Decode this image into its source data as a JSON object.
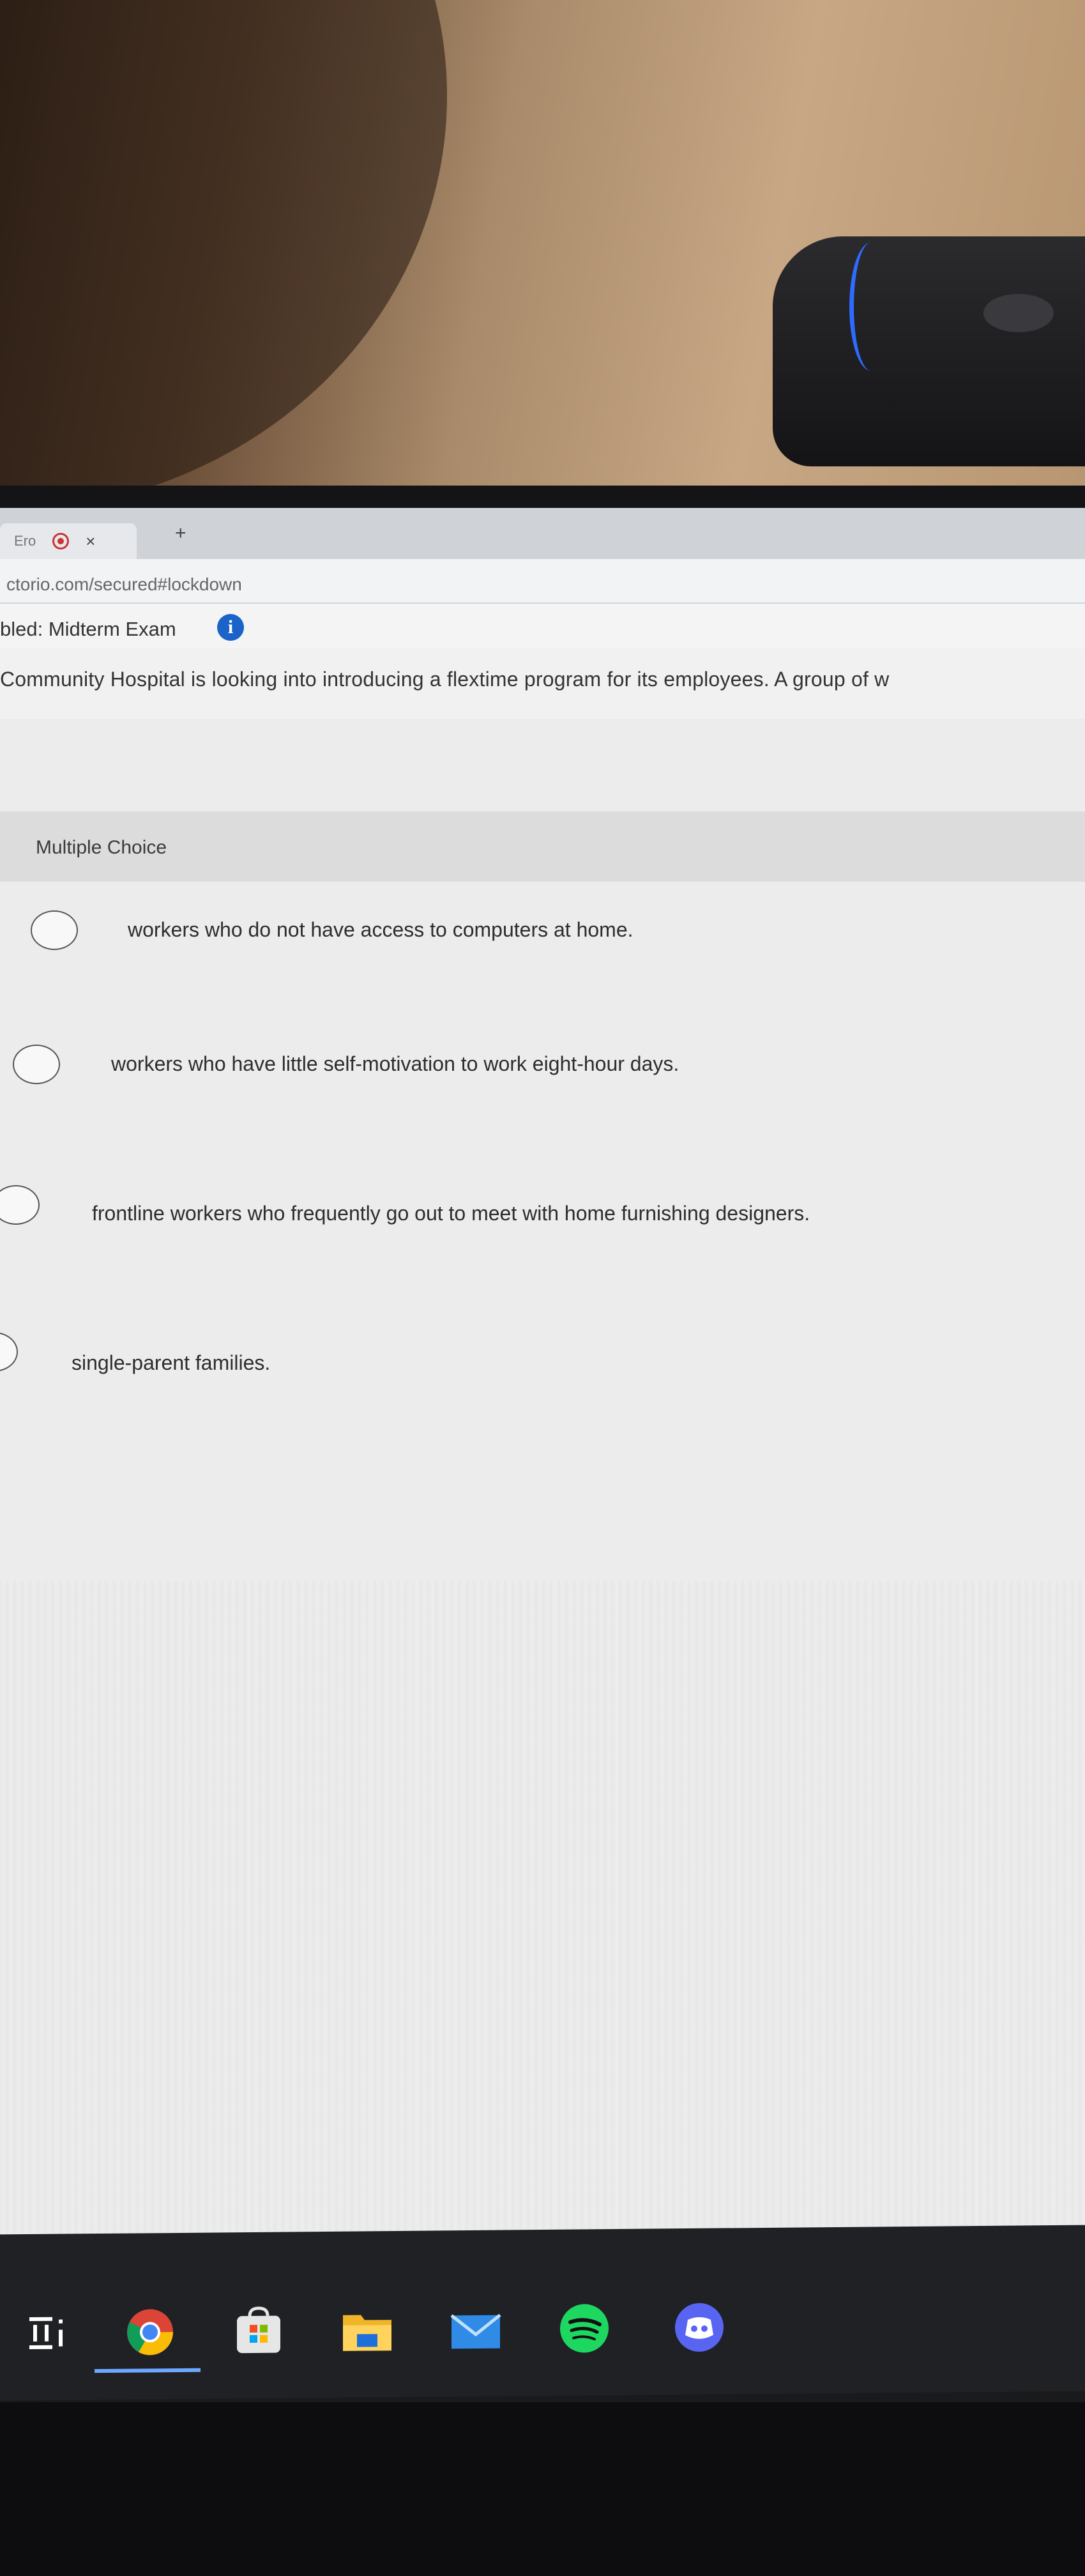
{
  "browser": {
    "tab_title": "Ero",
    "new_tab_glyph": "+",
    "close_glyph": "×",
    "url": "ctorio.com/secured#lockdown"
  },
  "exam": {
    "title": "bled: Midterm Exam",
    "info_glyph": "i",
    "question": "Community Hospital is looking into introducing a flextime program for its employees. A group of w",
    "format_label": "Multiple Choice",
    "choices": [
      "workers who do not have access to computers at home.",
      "workers who have little self-motivation to work eight-hour days.",
      "frontline workers who frequently go out to meet with home furnishing designers.",
      "single-parent families."
    ]
  },
  "taskbar": {
    "apps": [
      "task-view-icon",
      "chrome-icon",
      "store-icon",
      "file-explorer-icon",
      "mail-icon",
      "spotify-icon",
      "discord-icon"
    ]
  },
  "colors": {
    "info_blue": "#1c63c9",
    "spotify_green": "#1ed760",
    "discord_blue": "#5865f2",
    "chrome_active": "#6da7ff"
  }
}
